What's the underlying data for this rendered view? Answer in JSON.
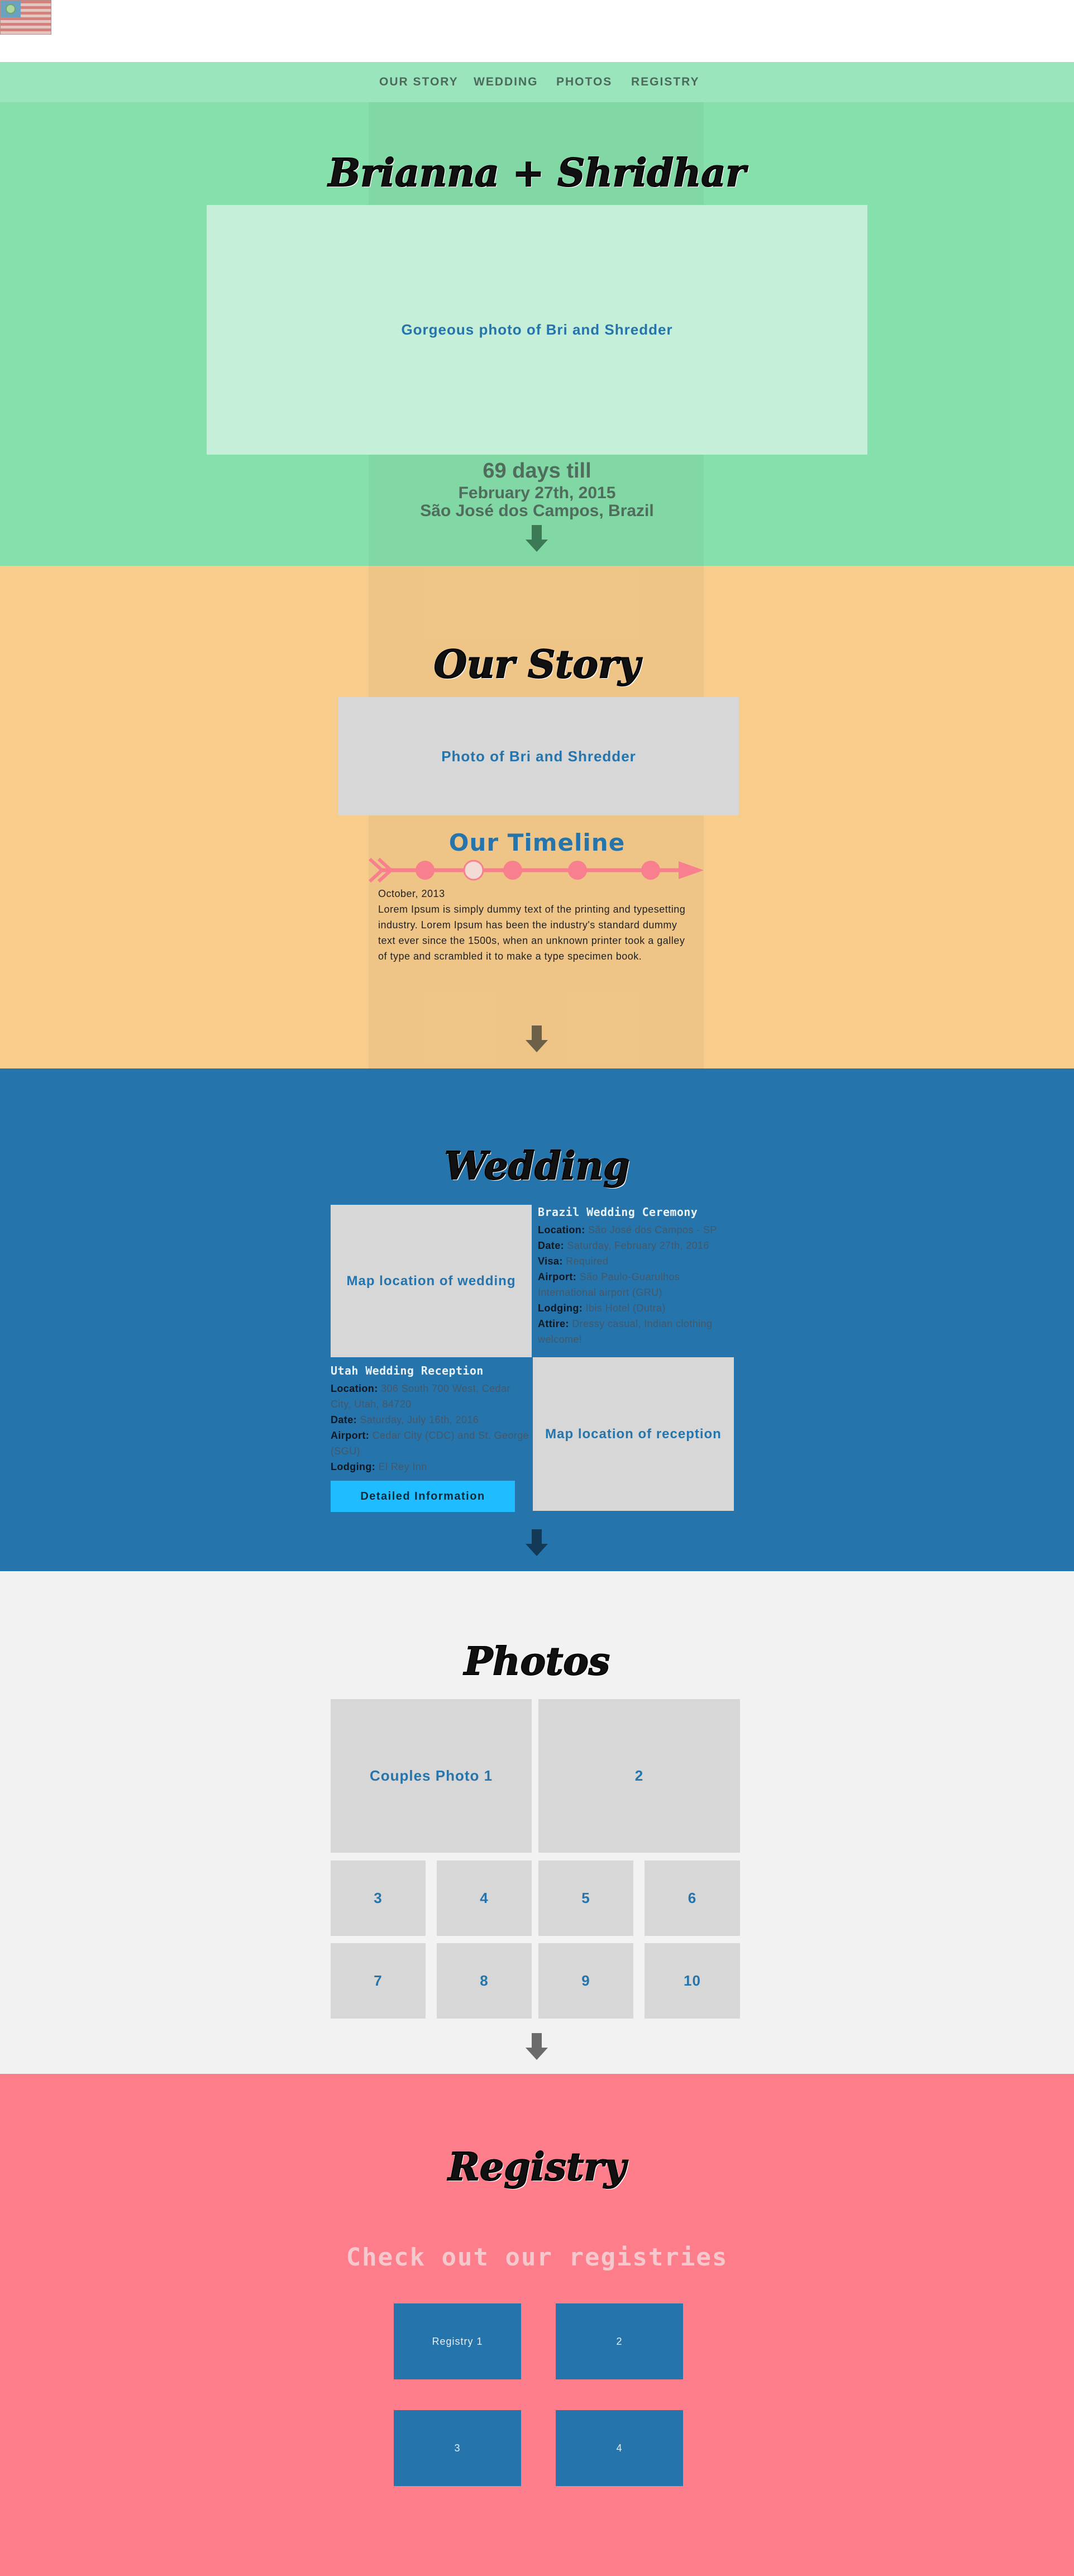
{
  "nav": {
    "items": [
      "OUR STORY",
      "WEDDING",
      "PHOTOS",
      "REGISTRY"
    ]
  },
  "hero": {
    "title": "Brianna + Shridhar",
    "photo_label": "Gorgeous photo of  Bri and Shredder",
    "countdown": "69 days till",
    "date": "February 27th, 2015",
    "place": "São José dos Campos, Brazil"
  },
  "story": {
    "title": "Our Story",
    "photo_label": "Photo of Bri and Shredder",
    "timeline_title": "Our Timeline",
    "timeline_date": "October, 2013",
    "timeline_text": "Lorem Ipsum is simply dummy text of the printing and typesetting industry. Lorem Ipsum has been the industry's standard dummy text ever since the 1500s, when an unknown printer took a galley of type and scrambled it to make a type specimen book."
  },
  "wedding": {
    "title": "Wedding",
    "map_wedding_label": "Map location of wedding",
    "map_reception_label": "Map location of reception",
    "brazil": {
      "heading": "Brazil Wedding Ceremony",
      "location_label": "Location",
      "location": "São José dos Campos - SP",
      "date_label": "Date",
      "date": "Saturday, February 27th, 2016",
      "visa_label": "Visa",
      "visa": "Required",
      "airport_label": "Airport",
      "airport": "São Paulo-Guarulhos International airport (GRU)",
      "lodging_label": "Lodging",
      "lodging": "Ibis Hotel (Dutra)",
      "attire_label": "Attire",
      "attire": "Dressy casual, Indian clothing welcome!"
    },
    "utah": {
      "heading": "Utah Wedding Reception",
      "location_label": "Location",
      "location": "306 South 700 West, Cedar City, Utah, 84720",
      "date_label": "Date",
      "date": "Saturday, July 16th, 2016",
      "airport_label": "Airport",
      "airport": "Cedar City (CDC) and St. George (SGU)",
      "lodging_label": "Lodging",
      "lodging": "El Rey Inn"
    },
    "button_label": "Detailed Information"
  },
  "photos": {
    "title": "Photos",
    "tiles": [
      "Couples Photo 1",
      "2",
      "3",
      "4",
      "5",
      "6",
      "7",
      "8",
      "9",
      "10"
    ]
  },
  "registry": {
    "title": "Registry",
    "subtitle": "Check out our registries",
    "items": [
      "Registry 1",
      "2",
      "3",
      "4"
    ]
  },
  "colors": {
    "hero": "#86e0ac",
    "story": "#f8cd8c",
    "wedding": "#2574ab",
    "photos": "#f2f2f2",
    "registry": "#fe7d8b",
    "timeline": "#f77f8e",
    "button": "#1fbcff"
  },
  "icons": {
    "flag": "brazil-flag-icon",
    "arrow": "down-arrow-icon"
  }
}
